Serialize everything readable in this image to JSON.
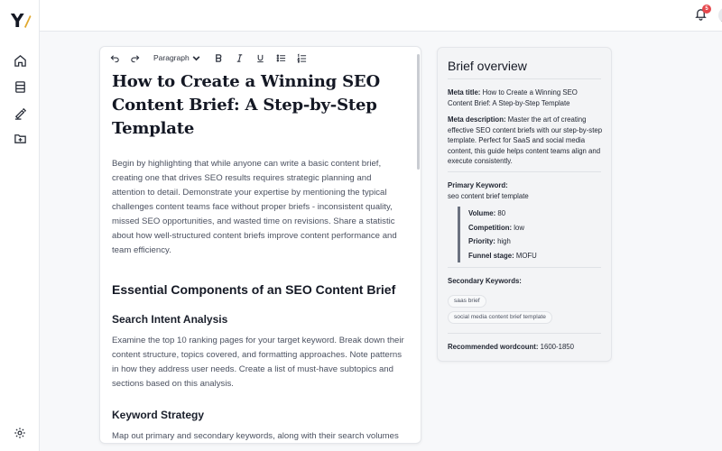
{
  "topbar": {
    "notifications_count": "5"
  },
  "toolbar": {
    "block_type": "Paragraph"
  },
  "document": {
    "title": "How to Create a Winning SEO Content Brief: A Step-by-Step Template",
    "intro": "Begin by highlighting that while anyone can write a basic content brief, creating one that drives SEO results requires strategic planning and attention to detail. Demonstrate your expertise by mentioning the typical challenges content teams face without proper briefs - inconsistent quality, missed SEO opportunities, and wasted time on revisions. Share a statistic about how well-structured content briefs improve content performance and team efficiency.",
    "h2": "Essential Components of an SEO Content Brief",
    "section1_title": "Search Intent Analysis",
    "section1_body": "Examine the top 10 ranking pages for your target keyword. Break down their content structure, topics covered, and formatting approaches. Note patterns in how they address user needs. Create a list of must-have subtopics and sections based on this analysis.",
    "section2_title": "Keyword Strategy",
    "section2_body": "Map out primary and secondary keywords, along with their search volumes and difficulty scores. Include LSI keywords and semantic variations. Provide specific placement recommendations for each keyword type within the"
  },
  "brief": {
    "title": "Brief overview",
    "meta_title_label": "Meta title:",
    "meta_title": "How to Create a Winning SEO Content Brief: A Step-by-Step Template",
    "meta_desc_label": "Meta description:",
    "meta_desc": "Master the art of creating effective SEO content briefs with our step-by-step template. Perfect for SaaS and social media content, this guide helps content teams align and execute consistently.",
    "primary_label": "Primary Keyword:",
    "primary_keyword": "seo content brief template",
    "volume_label": "Volume:",
    "volume": "80",
    "competition_label": "Competition:",
    "competition": "low",
    "priority_label": "Priority:",
    "priority": "high",
    "funnel_label": "Funnel stage:",
    "funnel": "MOFU",
    "secondary_label": "Secondary Keywords:",
    "secondary_keywords": [
      "saas brief",
      "social media content brief template"
    ],
    "wordcount_label": "Recommended wordcount:",
    "wordcount": "1600-1850"
  },
  "colors": {
    "badge": "#e5484d",
    "accent_bar": "#6b7280"
  }
}
